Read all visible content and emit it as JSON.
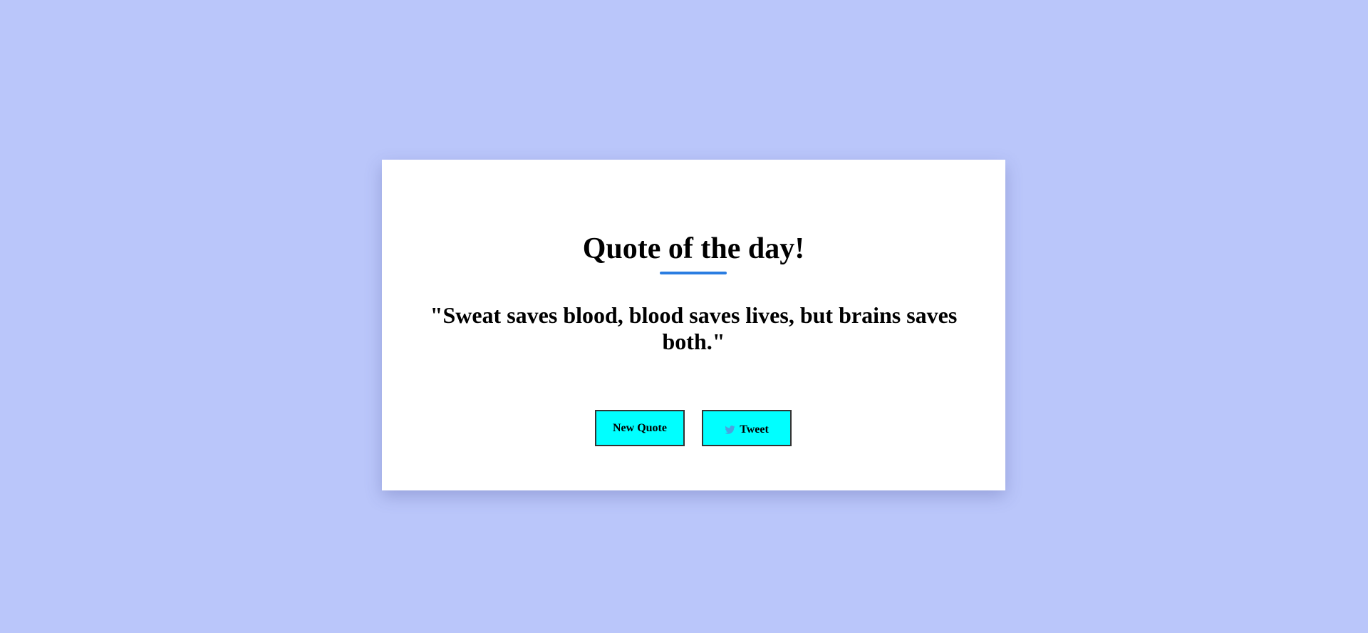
{
  "page": {
    "background_color": "#bac6fa"
  },
  "card": {
    "title": "Quote of the day!",
    "accent_color": "#2a7de1",
    "quote": "\"Sweat saves blood, blood saves lives, but brains saves both.\""
  },
  "buttons": {
    "new_quote_label": "New Quote",
    "tweet_label": "Tweet",
    "tweet_icon": "twitter-icon",
    "button_color": "#00ffff"
  }
}
